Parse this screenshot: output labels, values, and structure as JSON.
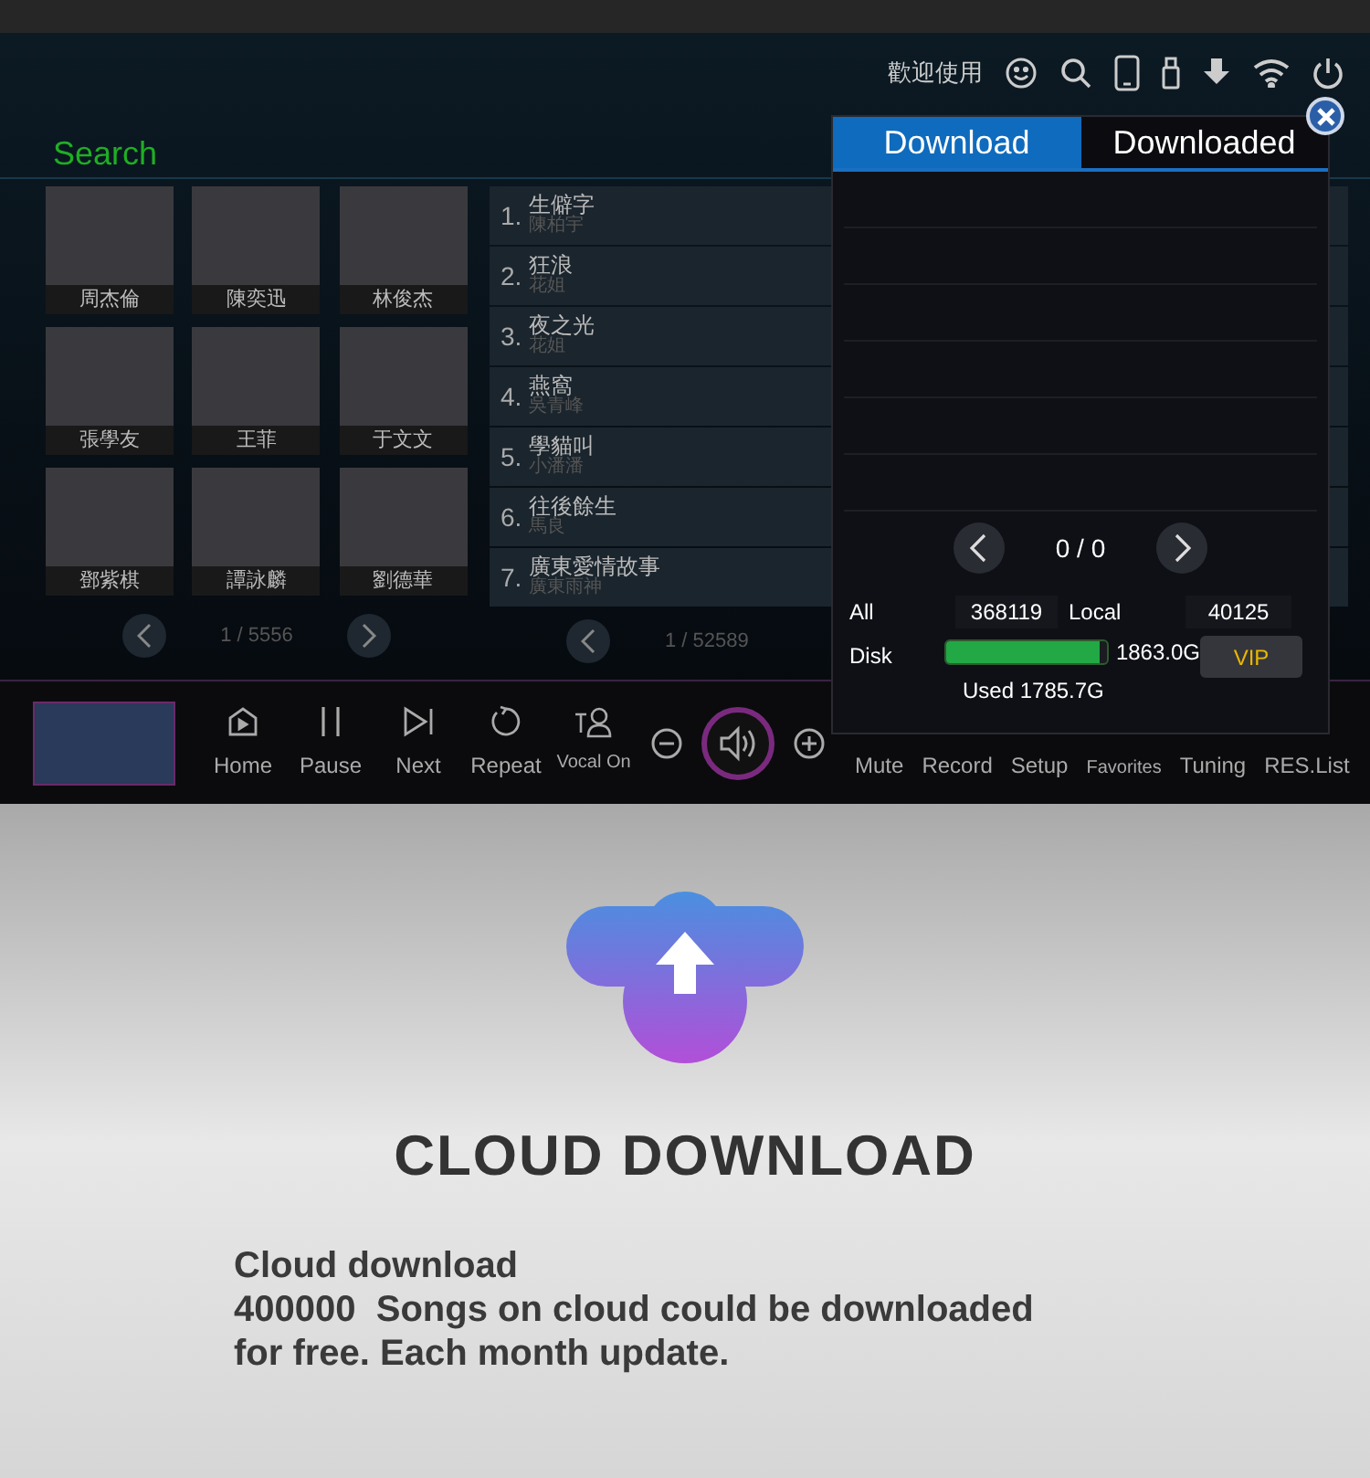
{
  "header": {
    "welcome": "歡迎使用"
  },
  "search_title": "Search",
  "artists": [
    {
      "name": "周杰倫"
    },
    {
      "name": "陳奕迅"
    },
    {
      "name": "林俊杰"
    },
    {
      "name": "張學友"
    },
    {
      "name": "王菲"
    },
    {
      "name": "于文文"
    },
    {
      "name": "鄧紫棋"
    },
    {
      "name": "譚詠麟"
    },
    {
      "name": "劉德華"
    }
  ],
  "artist_pager": "1 / 5556",
  "songs": [
    {
      "number": "1.",
      "title": "生僻字",
      "singer": "陳柏宇"
    },
    {
      "number": "2.",
      "title": "狂浪",
      "singer": "花姐"
    },
    {
      "number": "3.",
      "title": "夜之光",
      "singer": "花姐"
    },
    {
      "number": "4.",
      "title": "燕窩",
      "singer": "吳青峰"
    },
    {
      "number": "5.",
      "title": "學貓叫",
      "singer": "小潘潘"
    },
    {
      "number": "6.",
      "title": "往後餘生",
      "singer": "馬良"
    },
    {
      "number": "7.",
      "title": "廣東愛情故事",
      "singer": "廣東雨神"
    }
  ],
  "song_pager": "1 / 52589",
  "controls": [
    {
      "kind": "home",
      "label": "Home"
    },
    {
      "kind": "pause",
      "label": "Pause"
    },
    {
      "kind": "next",
      "label": "Next"
    },
    {
      "kind": "repeat",
      "label": "Repeat"
    },
    {
      "kind": "vocal",
      "label": "Vocal On"
    }
  ],
  "right_controls": [
    "Mute",
    "Record",
    "Setup",
    "Favorites",
    "Tuning",
    "RES.List"
  ],
  "popup": {
    "tabs": [
      {
        "label": "Download",
        "selected": true
      },
      {
        "label": "Downloaded",
        "selected": false
      }
    ],
    "pager": "0 / 0",
    "all_label": "All",
    "all_value": "368119",
    "local_label": "Local",
    "local_value": "40125",
    "disk_label": "Disk",
    "disk": {
      "level": 0.96
    },
    "disk_total": "1863.0G",
    "disk_used": "Used 1785.7G",
    "vip": "VIP"
  },
  "promo": {
    "title": "CLOUD DOWNLOAD",
    "lines": [
      "Cloud download",
      "400000  Songs on cloud could be downloaded",
      "for free. Each month update."
    ]
  }
}
